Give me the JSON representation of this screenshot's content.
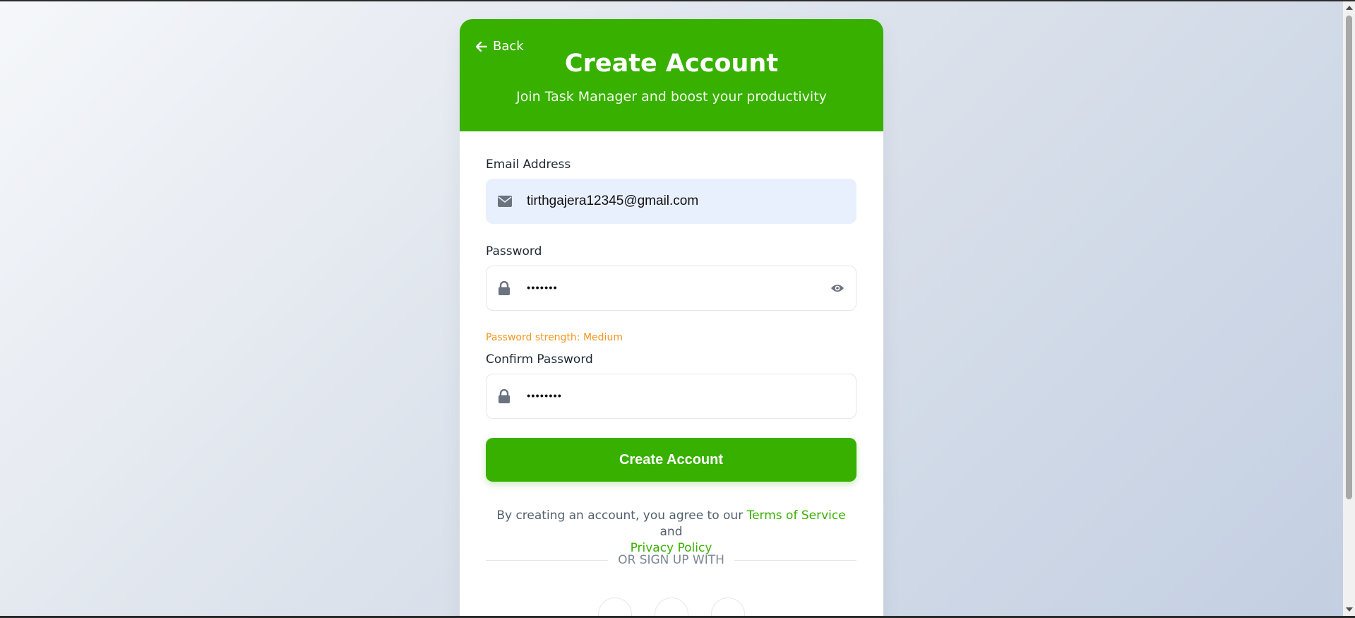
{
  "header": {
    "back_label": "Back",
    "title": "Create Account",
    "subtitle": "Join Task Manager and boost your productivity"
  },
  "form": {
    "email": {
      "label": "Email Address",
      "value": "tirthgajera12345@gmail.com",
      "icon": "envelope-icon"
    },
    "password": {
      "label": "Password",
      "value": "•••••••",
      "icon": "lock-icon",
      "toggle_icon": "eye-icon",
      "strength_text": "Password strength: Medium"
    },
    "confirm_password": {
      "label": "Confirm Password",
      "value": "••••••••",
      "icon": "lock-icon"
    },
    "submit_label": "Create Account"
  },
  "terms": {
    "prefix": "By creating an account, you agree to our",
    "terms_link": "Terms of Service",
    "conjunction": "and",
    "privacy_link": "Privacy Policy"
  },
  "divider_text": "OR SIGN UP WITH",
  "colors": {
    "brand_green": "#38b000",
    "strength_medium": "#f7941d",
    "icon_gray": "#6b7280"
  }
}
